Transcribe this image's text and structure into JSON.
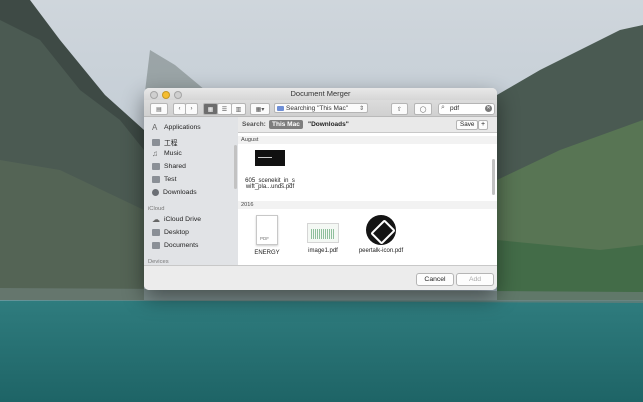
{
  "window": {
    "title": "Document Merger"
  },
  "toolbar": {
    "location_label": "Searching \"This Mac\"",
    "search_value": "pdf"
  },
  "scope": {
    "label": "Search:",
    "this_mac": "This Mac",
    "downloads": "\"Downloads\"",
    "save_label": "Save",
    "add_label": "+"
  },
  "sidebar": {
    "favorites": [
      {
        "label": "Applications",
        "icon": "applications-icon"
      },
      {
        "label": "工程",
        "icon": "folder-icon"
      },
      {
        "label": "Music",
        "icon": "music-icon"
      },
      {
        "label": "Shared",
        "icon": "folder-icon"
      },
      {
        "label": "Test",
        "icon": "folder-icon"
      },
      {
        "label": "Downloads",
        "icon": "downloads-icon"
      }
    ],
    "icloud_header": "iCloud",
    "icloud": [
      {
        "label": "iCloud Drive",
        "icon": "cloud-icon"
      },
      {
        "label": "Desktop",
        "icon": "folder-icon"
      },
      {
        "label": "Documents",
        "icon": "folder-icon"
      }
    ],
    "devices_header": "Devices"
  },
  "groups": [
    {
      "header": "August",
      "files": [
        {
          "name_line1": "605_scenekit_in_s",
          "name_line2": "wift_pla...unds.pdf"
        }
      ]
    },
    {
      "header": "2016",
      "files": [
        {
          "name_line1": "ENERGY",
          "name_line2": ""
        },
        {
          "name_line1": "image1.pdf",
          "name_line2": ""
        },
        {
          "name_line1": "peertalk-icon.pdf",
          "name_line2": ""
        }
      ]
    }
  ],
  "footer": {
    "cancel_label": "Cancel",
    "add_label": "Add"
  },
  "colors": {
    "accent": "#6d6d6d",
    "window_bg": "#ececec",
    "sidebar_bg": "#e1e3e6"
  }
}
